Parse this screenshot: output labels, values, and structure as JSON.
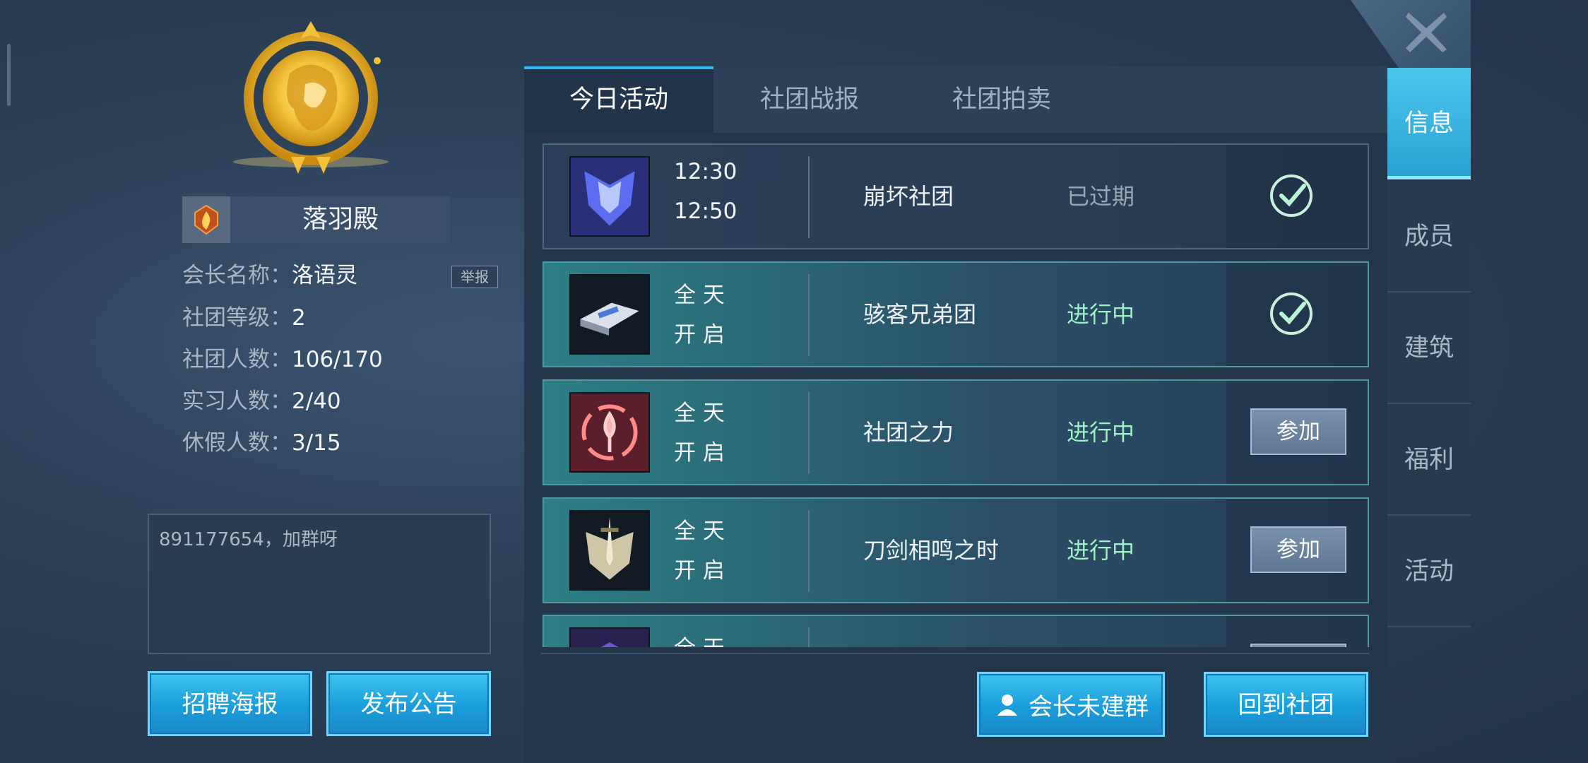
{
  "guild": {
    "name": "落羽殿",
    "leader_label": "会长名称：",
    "leader_value": "洛语灵",
    "report_label": "举报",
    "level_label": "社团等级：",
    "level_value": "2",
    "members_label": "社团人数：",
    "members_value": "106/170",
    "interns_label": "实习人数：",
    "interns_value": "2/40",
    "vacation_label": "休假人数：",
    "vacation_value": "3/15",
    "notice_text": "891177654，加群呀"
  },
  "left_buttons": {
    "recruit": "招聘海报",
    "announce": "发布公告"
  },
  "tabs": [
    {
      "label": "今日活动"
    },
    {
      "label": "社团战报"
    },
    {
      "label": "社团拍卖"
    }
  ],
  "activities": [
    {
      "time1": "12:30",
      "time2": "12:50",
      "name": "崩坏社团",
      "status": "已过期",
      "action": "check"
    },
    {
      "time1": "全 天",
      "time2": "开 启",
      "name": "骇客兄弟团",
      "status": "进行中",
      "action": "check"
    },
    {
      "time1": "全 天",
      "time2": "开 启",
      "name": "社团之力",
      "status": "进行中",
      "action": "参加"
    },
    {
      "time1": "全 天",
      "time2": "开 启",
      "name": "刀剑相鸣之时",
      "status": "进行中",
      "action": "参加"
    },
    {
      "time1": "全 天"
    }
  ],
  "bottom_buttons": {
    "no_group": "会长未建群",
    "back": "回到社团"
  },
  "sidenav": [
    {
      "label": "信息"
    },
    {
      "label": "成员"
    },
    {
      "label": "建筑"
    },
    {
      "label": "福利"
    },
    {
      "label": "活动"
    }
  ],
  "colors": {
    "accent": "#35b7f0",
    "status_active": "#9ff0c6",
    "status_expired": "#9aa8b6"
  },
  "icons": {
    "close": "close-x-icon",
    "guild_badge": "lion-emblem-icon",
    "guild_small": "flame-badge-icon",
    "check": "check-circle-icon",
    "group": "person-icon"
  }
}
